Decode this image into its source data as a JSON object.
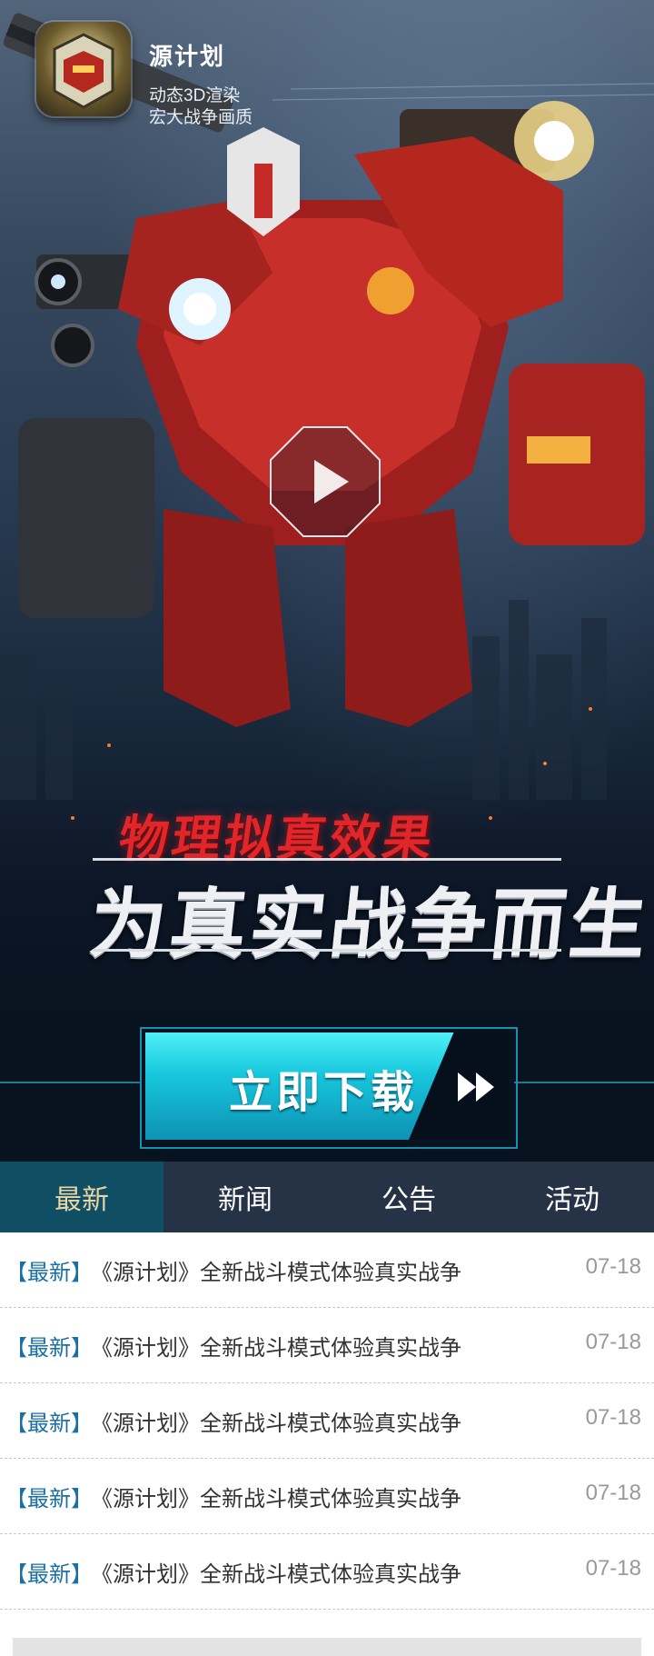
{
  "app": {
    "name": "源计划",
    "tagline_line1": "动态3D渲染",
    "tagline_line2": "宏大战争画质"
  },
  "hero": {
    "slogan_top": "物理拟真效果",
    "slogan_main": "为真实战争而生",
    "play_icon": "play-icon"
  },
  "download": {
    "label": "立即下载",
    "icon": "fast-forward-icon"
  },
  "tabs": [
    {
      "label": "最新",
      "active": true
    },
    {
      "label": "新闻",
      "active": false
    },
    {
      "label": "公告",
      "active": false
    },
    {
      "label": "活动",
      "active": false
    }
  ],
  "news": [
    {
      "tag": "【最新】",
      "title": "《源计划》全新战斗模式体验真实战争",
      "date": "07-18"
    },
    {
      "tag": "【最新】",
      "title": "《源计划》全新战斗模式体验真实战争",
      "date": "07-18"
    },
    {
      "tag": "【最新】",
      "title": "《源计划》全新战斗模式体验真实战争",
      "date": "07-18"
    },
    {
      "tag": "【最新】",
      "title": "《源计划》全新战斗模式体验真实战争",
      "date": "07-18"
    },
    {
      "tag": "【最新】",
      "title": "《源计划》全新战斗模式体验真实战争",
      "date": "07-18"
    }
  ],
  "colors": {
    "accent_cyan": "#17c6dc",
    "tab_bar": "#263346",
    "tab_active": "#0f4e63",
    "tab_active_text": "#ead6a4",
    "news_tag": "#1a6fa4",
    "slogan_red": "#e0262a"
  }
}
